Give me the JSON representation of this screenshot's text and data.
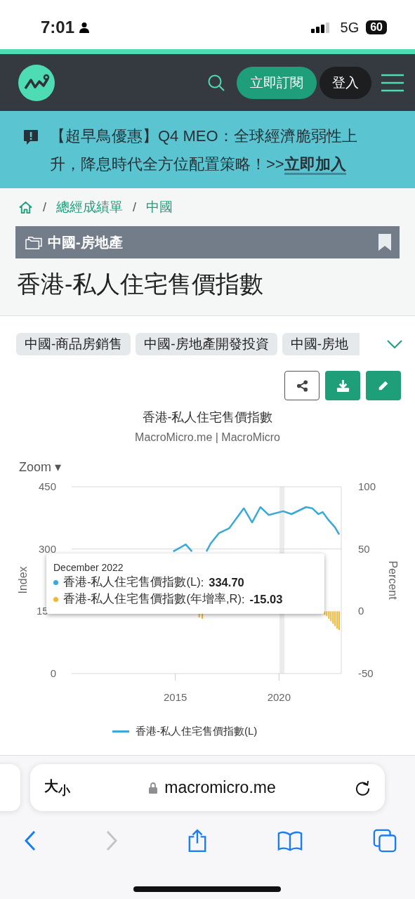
{
  "status_bar": {
    "time": "7:01",
    "network": "5G",
    "battery": "60"
  },
  "header": {
    "subscribe": "立即訂閱",
    "login": "登入"
  },
  "banner": {
    "text": "【超早鳥優惠】Q4 MEO：全球經濟脆弱性上升，降息時代全方位配置策略！>>",
    "link": "立即加入"
  },
  "breadcrumb": [
    {
      "separator": "/",
      "label": "總經成績單"
    },
    {
      "separator": "/",
      "label": "中國"
    }
  ],
  "category": "中國-房地產",
  "title": "香港-私人住宅售價指數",
  "tags": [
    "中國-商品房銷售",
    "中國-房地產開發投資",
    "中國-房地"
  ],
  "chart": {
    "title": "香港-私人住宅售價指數",
    "subtitle": "MacroMicro.me | MacroMicro",
    "zoom": "Zoom ▾",
    "chart_data": {
      "type": "line",
      "ylabel": "Index",
      "xlim": [
        2010,
        2023
      ],
      "ylim": [
        0,
        450
      ],
      "xticks": [
        2015,
        2020
      ],
      "yticks": [
        0,
        300,
        450
      ],
      "x": [
        2014.9,
        2015.5,
        2015.8,
        2016.0,
        2016.3,
        2016.5,
        2016.7,
        2017.1,
        2017.6,
        2018.3,
        2018.7,
        2019.1,
        2019.5,
        2020.2,
        2020.6,
        2021.3,
        2021.6,
        2021.9,
        2022.1,
        2022.4,
        2022.7,
        2022.9
      ],
      "series": [
        {
          "name": "香港-私人住宅售價指數(L)",
          "color": "#3aa9d8",
          "values": [
            294,
            311,
            294,
            null,
            null,
            294,
            313,
            338,
            350,
            398,
            364,
            401,
            382,
            391,
            384,
            401,
            398,
            384,
            389,
            369,
            352,
            335
          ]
        }
      ]
    },
    "growth_chart": {
      "chart_data": {
        "type": "bar",
        "ylabel": "Percent",
        "xlim": [
          2010,
          2023
        ],
        "ylim": [
          -50,
          100
        ],
        "yticks": [
          -50,
          0,
          50,
          100
        ],
        "x": [
          2016.15,
          2016.3,
          2022.2,
          2022.3,
          2022.4,
          2022.5,
          2022.6,
          2022.7,
          2022.8,
          2022.9
        ],
        "series": [
          {
            "name": "香港-私人住宅售價指數(年增率,R)",
            "color": "#f0b83a",
            "values": [
              -5,
              -6,
              -3,
              -4,
              -6,
              -8,
              -10,
              -12,
              -14,
              -15
            ]
          }
        ]
      }
    },
    "covered_y_tick": "15",
    "tooltip": {
      "heading": "December 2022",
      "entries": [
        {
          "separator": ":",
          "value": "334.70",
          "color": "#3aa9d8"
        },
        {
          "separator": ":",
          "value": "-15.03",
          "color": "#f0b83a"
        }
      ]
    }
  },
  "browser": {
    "text_size": "大$_{小}$",
    "url": "macromicro.me",
    "nav": [
      {
        "kind": "back",
        "disabled": false
      },
      {
        "kind": "forward",
        "disabled": true
      },
      {
        "kind": "share",
        "disabled": false
      },
      {
        "kind": "bookmarks",
        "disabled": false
      },
      {
        "kind": "tabs",
        "disabled": false
      }
    ]
  }
}
